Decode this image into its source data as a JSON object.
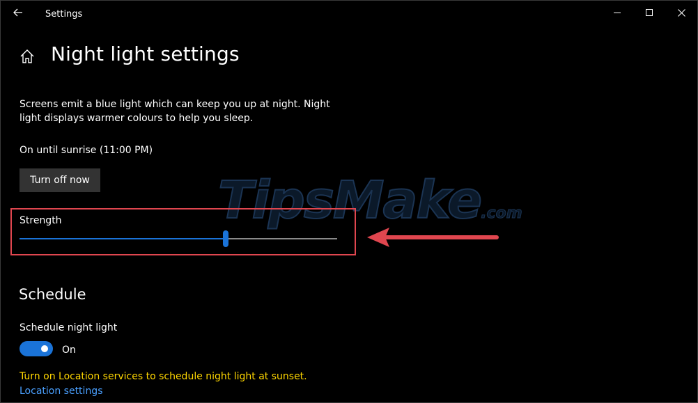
{
  "window": {
    "title": "Settings"
  },
  "header": {
    "title": "Night light settings"
  },
  "night_light": {
    "description": "Screens emit a blue light which can keep you up at night. Night light displays warmer colours to help you sleep.",
    "status": "On until sunrise (11:00 PM)",
    "turn_off_label": "Turn off now",
    "strength_label": "Strength",
    "strength_value": 0.65
  },
  "schedule": {
    "heading": "Schedule",
    "toggle_label": "Schedule night light",
    "toggle_state": "On",
    "toggle_on": true,
    "location_warning": "Turn on Location services to schedule night light at sunset.",
    "location_link": "Location settings"
  },
  "watermark": {
    "brand": "TipsMake",
    "suffix": ".com"
  },
  "colors": {
    "accent": "#1a73d8",
    "highlight": "#e0464f",
    "warning": "#ffd700",
    "link": "#4aa0ff"
  },
  "icons": {
    "back": "back-arrow-icon",
    "home": "home-icon",
    "minimize": "minimize-icon",
    "maximize": "maximize-icon",
    "close": "close-icon",
    "annotation": "red-arrow-icon"
  }
}
